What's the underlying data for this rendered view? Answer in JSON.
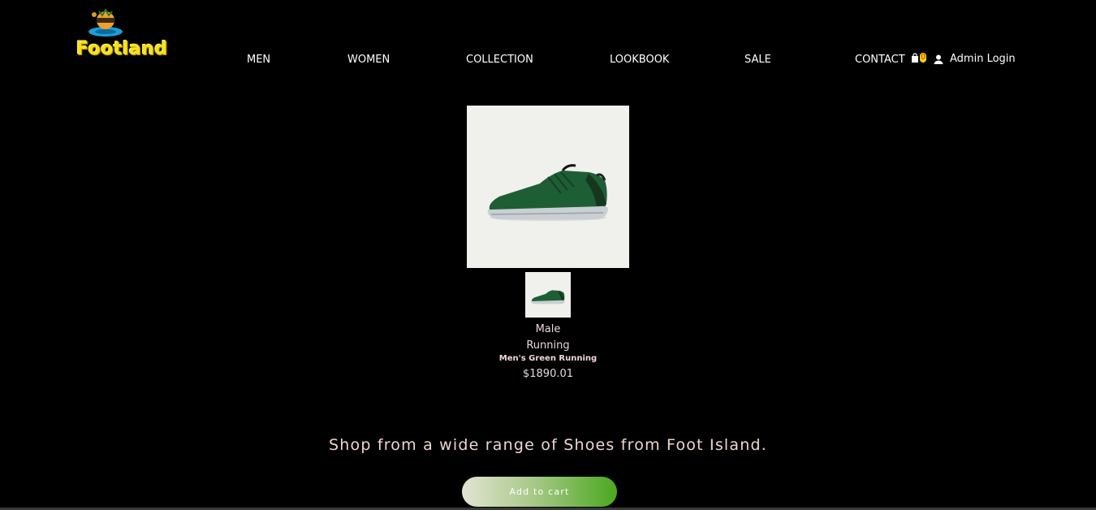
{
  "brand": {
    "name": "Footland"
  },
  "nav": {
    "men": "MEN",
    "women": "WOMEN",
    "collection": "COLLECTION",
    "lookbook": "LOOKBOOK",
    "sale": "SALE",
    "contact": "CONTACT",
    "cart_count": "0",
    "admin_login": "Admin Login"
  },
  "product": {
    "gender": "Male",
    "category": "Running",
    "name": "Men's Green Running",
    "price": "$1890.01"
  },
  "tagline": "Shop from a wide range of Shoes from Foot Island.",
  "add_to_cart": "Add to cart",
  "colors": {
    "background": "#000000",
    "logo_yellow": "#f5e21a",
    "shoe_green": "#1e5e34",
    "button_gradient_end": "#4aa81f"
  },
  "icons": {
    "cart": "shopping-bag-icon",
    "admin": "user-icon"
  }
}
